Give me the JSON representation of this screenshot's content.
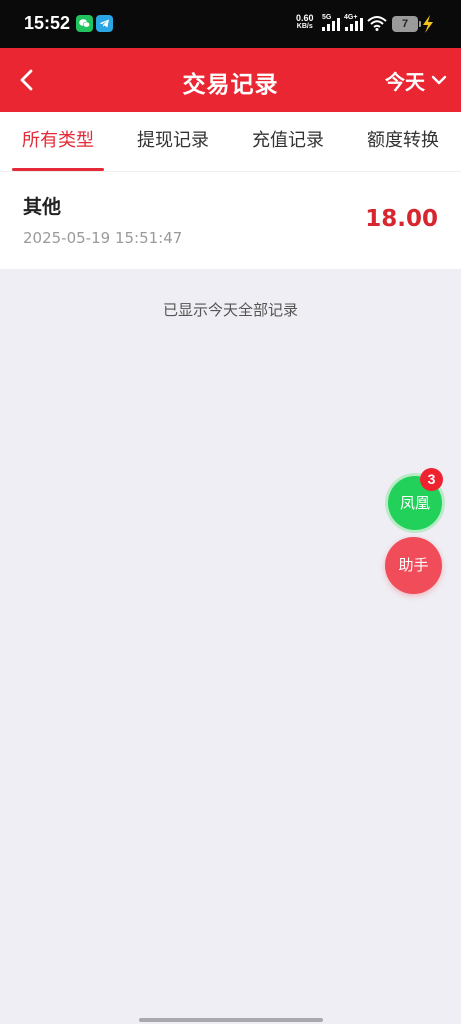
{
  "status_bar": {
    "time": "15:52",
    "speed_value": "0.60",
    "speed_unit": "KB/s",
    "net1": "5G",
    "net2": "4G+",
    "battery": "7"
  },
  "header": {
    "title": "交易记录",
    "date_filter": "今天",
    "background": "#ea2633"
  },
  "tabs": [
    {
      "label": "所有类型",
      "active": true
    },
    {
      "label": "提现记录",
      "active": false
    },
    {
      "label": "充值记录",
      "active": false
    },
    {
      "label": "额度转换",
      "active": false
    }
  ],
  "records": [
    {
      "type": "其他",
      "time": "2025-05-19 15:51:47",
      "amount": "18.00"
    }
  ],
  "empty_note": "已显示今天全部记录",
  "floating": {
    "primary_label": "凤凰",
    "badge": "3",
    "secondary_label": "助手"
  },
  "colors": {
    "accent": "#e42a36",
    "amount": "#d7262f",
    "fab_green": "#22d15a",
    "fab_red": "#f04c5a"
  }
}
